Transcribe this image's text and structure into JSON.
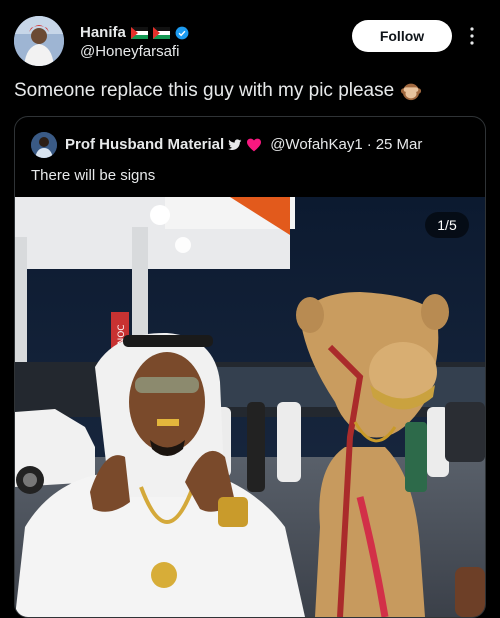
{
  "author": {
    "display_name": "Hanifa",
    "handle": "@Honeyfarsafi",
    "flags": [
      "palestine-flag-icon",
      "palestine-flag-icon"
    ],
    "verified_icon": "verified-badge-icon"
  },
  "follow_label": "Follow",
  "more_icon": "more-vertical-icon",
  "post_text": "Someone replace this guy with my pic please",
  "post_emoji": "see-no-evil-monkey-icon",
  "quote": {
    "display_name": "Prof Husband Material",
    "handle": "@WofahKay1",
    "separator": "·",
    "date": "25 Mar",
    "text": "There will be signs",
    "name_icons": [
      "twitter-bird-icon",
      "red-heart-icon"
    ]
  },
  "media": {
    "counter": "1/5",
    "sign_text": "ADNOC",
    "description_icons": [
      "gas-station-canopy",
      "camel",
      "man-in-white-thobe"
    ]
  },
  "colors": {
    "background": "#000000",
    "text": "#e7e9ea",
    "border": "#2f3336",
    "verified": "#1d9bf0",
    "heart": "#f91880"
  }
}
